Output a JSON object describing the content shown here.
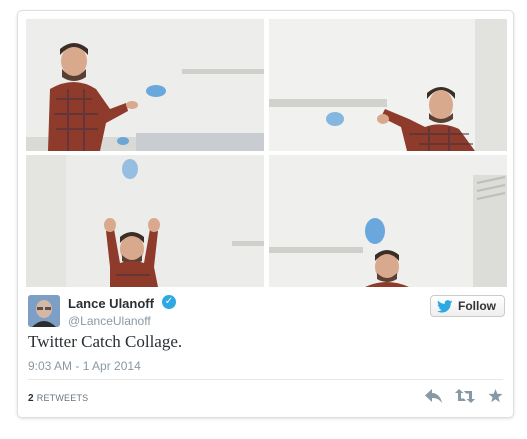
{
  "tweet": {
    "author_name": "Lance Ulanoff",
    "handle": "@LanceUlanoff",
    "text": "Twitter Catch Collage.",
    "timestamp": "9:03 AM - 1 Apr 2014",
    "retweet_count": "2",
    "retweet_label": "RETWEETS",
    "verified": true
  },
  "follow_button": {
    "label": "Follow"
  },
  "icons": {
    "follow": "twitter-bird-icon",
    "verified": "verified-badge-icon",
    "reply": "reply-icon",
    "retweet": "retweet-icon",
    "favorite": "favorite-star-icon"
  },
  "colors": {
    "accent": "#2ea8e3",
    "muted_text": "#8899a6",
    "action_icon": "#8899a6"
  }
}
